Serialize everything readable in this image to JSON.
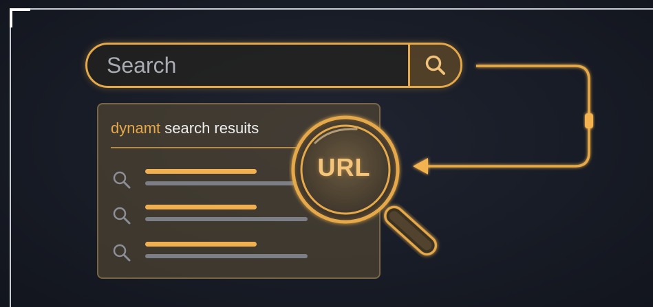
{
  "search": {
    "placeholder": "Search",
    "button_icon": "search-icon"
  },
  "results_panel": {
    "title_accent": "dynamt",
    "title_rest": " search resuits",
    "rows": [
      {
        "icon": "search-icon"
      },
      {
        "icon": "search-icon"
      },
      {
        "icon": "search-icon"
      }
    ]
  },
  "magnifier": {
    "label": "URL",
    "icon": "magnifying-glass-icon"
  },
  "connector": {
    "icon": "arrow-left-icon"
  },
  "colors": {
    "accent": "#e6a94a",
    "background": "#181c26",
    "panel": "#5f5037",
    "text_light": "#ededed",
    "muted_line": "#7d7f86"
  }
}
